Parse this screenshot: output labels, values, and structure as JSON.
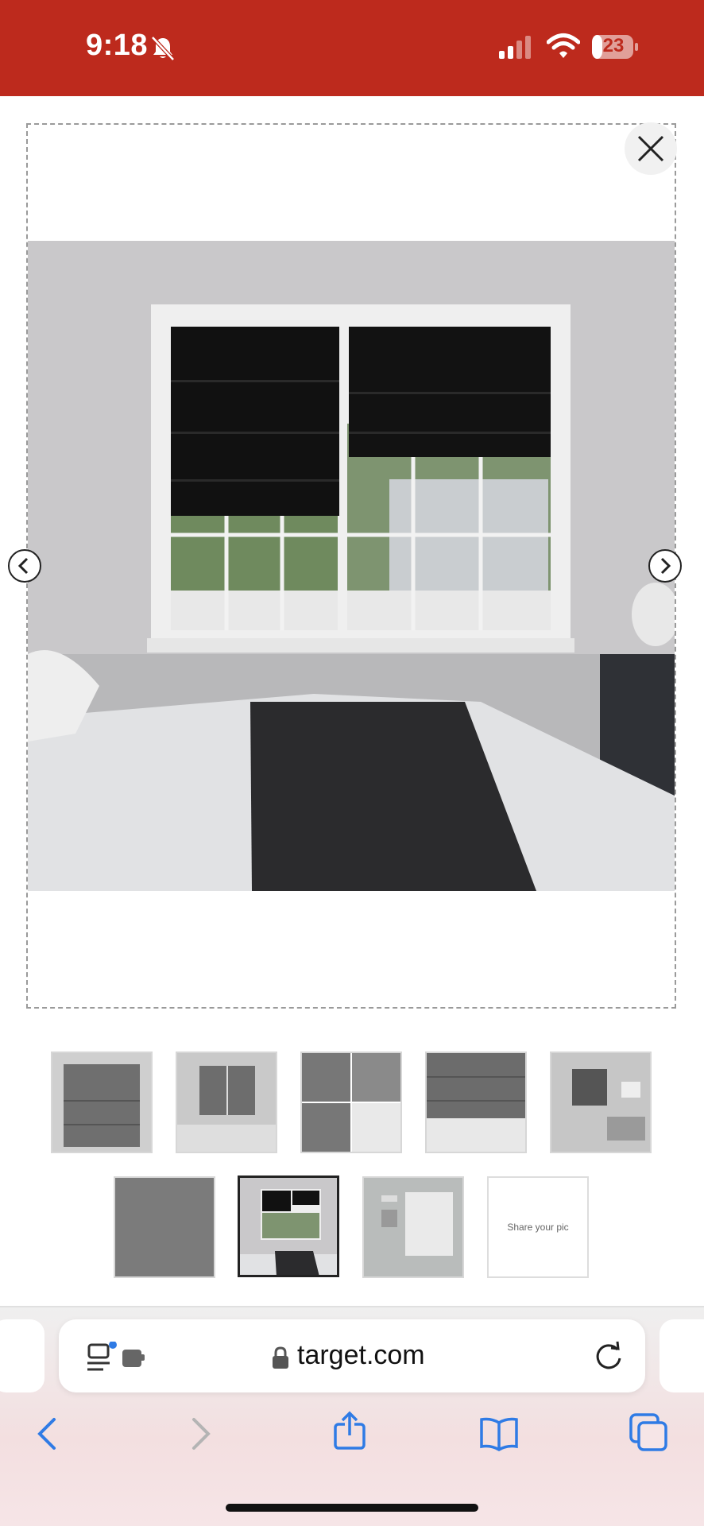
{
  "status_bar": {
    "time": "9:18",
    "battery": "23",
    "background": "#bd2a1d"
  },
  "viewer": {
    "close_icon": "close-icon",
    "prev_icon": "chevron-left-icon",
    "next_icon": "chevron-right-icon"
  },
  "thumbnails": {
    "share_label": "Share your pic"
  },
  "browser": {
    "url": "target.com",
    "accent": "#2f7be5"
  }
}
